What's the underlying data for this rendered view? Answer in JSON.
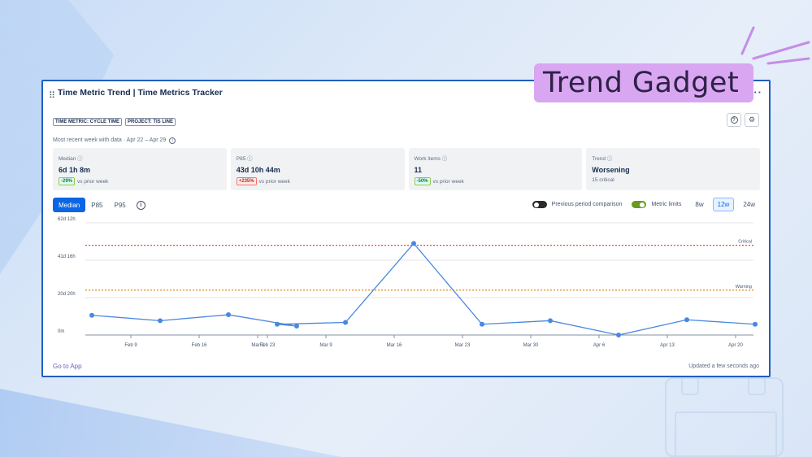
{
  "header": {
    "title": "Time Metric Trend | Time Metrics Tracker",
    "badges": [
      "TIME METRIC: CYCLE TIME",
      "PROJECT: TIS LINE"
    ],
    "recent_week": "Most recent week with data · Apr 22 – Apr 29"
  },
  "overlay_label": "Trend Gadget",
  "stats": [
    {
      "label": "Median",
      "value": "6d 1h 8m",
      "chip": "-29%",
      "chip_kind": "good",
      "sub": "vs prior week"
    },
    {
      "label": "P85",
      "value": "43d 10h 44m",
      "chip": "+235%",
      "chip_kind": "bad",
      "sub": "vs prior week"
    },
    {
      "label": "Work items",
      "value": "11",
      "chip": "-50%",
      "chip_kind": "good",
      "sub": "vs prior week"
    },
    {
      "label": "Trend",
      "value": "Worsening",
      "chip": "",
      "chip_kind": "",
      "sub": "15 critical"
    }
  ],
  "tabs": [
    "Median",
    "P85",
    "P95"
  ],
  "active_tab": "Median",
  "controls": {
    "previous_period_label": "Previous period comparison",
    "previous_period_on": false,
    "metric_limits_label": "Metric limits",
    "metric_limits_on": true,
    "ranges": [
      "8w",
      "12w",
      "24w"
    ],
    "active_range": "12w"
  },
  "footer": {
    "go_to_app": "Go to App",
    "updated": "Updated a few seconds ago"
  },
  "colors": {
    "accent": "#0c66e4",
    "line": "#4a88e0",
    "critical": "#e2483d",
    "warning": "#e07a00",
    "label_bg": "#d9a6f2"
  },
  "chart_data": {
    "type": "line",
    "x_ticks": [
      "Feb 9",
      "Feb 16",
      "Feb 23",
      "Mar 2",
      "Mar 9",
      "Mar 16",
      "Mar 23",
      "Mar 30",
      "Apr 6",
      "Apr 13",
      "Apr 20"
    ],
    "y_ticks": [
      "0m",
      "20d 20h",
      "41d 16h",
      "62d 12h"
    ],
    "ylim": [
      0,
      62.5
    ],
    "y_unit": "days",
    "series": [
      {
        "x": [
          "Feb 5",
          "Feb 12",
          "Feb 19",
          "Feb 26",
          "Mar 4",
          "Mar 11",
          "Mar 18",
          "Mar 25",
          "Apr 1",
          "Apr 8",
          "Apr 15",
          "Apr 22"
        ],
        "values": [
          11,
          8,
          11.3,
          5,
          6,
          7,
          51,
          6,
          8,
          0,
          8.5,
          6
        ]
      }
    ],
    "limits": [
      {
        "name": "Critical",
        "value": 50
      },
      {
        "name": "Warning",
        "value": 25
      }
    ]
  }
}
